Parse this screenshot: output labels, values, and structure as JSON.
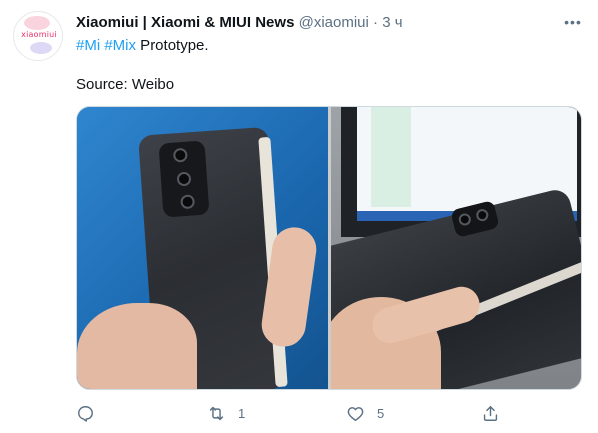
{
  "tweet": {
    "avatar_text": "xiaomiui",
    "author_name": "Xiaomiui | Xiaomi & MIUI News",
    "handle": "@xiaomiui",
    "separator": "·",
    "time": "3 ч",
    "text": {
      "hashtag1": "#Mi",
      "hashtag2": "#Mix",
      "rest": " Prototype.",
      "line2": "Source: Weibo"
    },
    "actions": {
      "reply_count": "",
      "retweet_count": "1",
      "like_count": "5"
    },
    "icons": {
      "more": "more-icon",
      "reply": "reply-icon",
      "retweet": "retweet-icon",
      "like": "heart-icon",
      "share": "share-icon"
    },
    "colors": {
      "link": "#1da1f2",
      "muted": "#5b7083",
      "text": "#0f1419"
    }
  }
}
